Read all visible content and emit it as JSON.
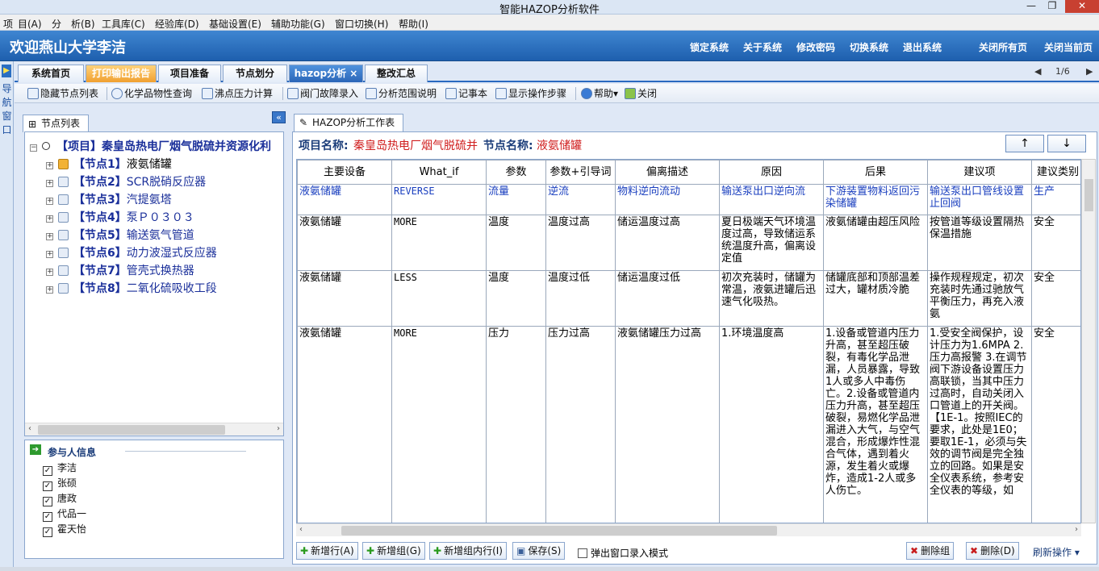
{
  "window": {
    "title": "智能HAZOP分析软件",
    "minimize": "—",
    "restore": "❐",
    "close": "✕"
  },
  "menu": [
    "项",
    "目(A)",
    "分　析(B)",
    "工具库(C)",
    "经验库(D)",
    "基础设置(E)",
    "辅助功能(G)",
    "窗口切换(H)",
    "帮助(I)"
  ],
  "banner": {
    "welcome": "欢迎燕山大学李洁",
    "links": [
      "锁定系统",
      "关于系统",
      "修改密码",
      "切换系统",
      "退出系统",
      "关闭所有页",
      "关闭当前页"
    ]
  },
  "leftnav": {
    "label": "导航窗口"
  },
  "tabs": [
    {
      "label": "系统首页"
    },
    {
      "label": "打印输出报告"
    },
    {
      "label": "项目准备"
    },
    {
      "label": "节点划分"
    },
    {
      "label": "hazop分析 ×"
    },
    {
      "label": "整改汇总"
    }
  ],
  "pager": {
    "page": "1/6"
  },
  "toolbar": [
    {
      "label": "隐藏节点列表"
    },
    {
      "label": "化学品物性查询"
    },
    {
      "label": "沸点压力计算"
    },
    {
      "label": "阀门故障录入"
    },
    {
      "label": "分析范围说明"
    },
    {
      "label": "记事本"
    },
    {
      "label": "显示操作步骤"
    },
    {
      "label": "帮助▾"
    },
    {
      "label": "关闭"
    }
  ],
  "node_panel": {
    "title": "节点列表",
    "collapse": "«",
    "root": "【项目】秦皇岛热电厂烟气脱硫并资源化利",
    "nodes": [
      {
        "num": "【节点1】",
        "name": "液氨储罐"
      },
      {
        "num": "【节点2】",
        "name": "SCR脱硝反应器"
      },
      {
        "num": "【节点3】",
        "name": "汽提氨塔"
      },
      {
        "num": "【节点4】",
        "name": "泵Ｐ０３０３"
      },
      {
        "num": "【节点5】",
        "name": "输送氨气管道"
      },
      {
        "num": "【节点6】",
        "name": "动力波湿式反应器"
      },
      {
        "num": "【节点7】",
        "name": "管壳式换热器"
      },
      {
        "num": "【节点8】",
        "name": "二氧化硫吸收工段"
      }
    ]
  },
  "participants": {
    "title": "参与人信息",
    "names": [
      "李洁",
      "张硕",
      "唐政",
      "代品一",
      "霍天怡"
    ]
  },
  "worksheet": {
    "tab": "HAZOP分析工作表",
    "project_label": "项目名称:",
    "project_value": "秦皇岛热电厂烟气脱硫并",
    "node_label": "节点名称:",
    "node_value": "液氨储罐",
    "up": "↑",
    "down": "↓"
  },
  "table": {
    "headers": [
      "主要设备",
      "What_if",
      "参数",
      "参数+引导词",
      "偏离描述",
      "原因",
      "后果",
      "建议项",
      "建议类别"
    ],
    "rows": [
      [
        "液氨储罐",
        "REVERSE",
        "流量",
        "逆流",
        "物料逆向流动",
        "输送泵出口逆向流",
        "下游装置物料返回污染储罐",
        "输送泵出口管线设置止回阀",
        "生产"
      ],
      [
        "液氨储罐",
        "MORE",
        "温度",
        "温度过高",
        "储运温度过高",
        "夏日极端天气环境温度过高，导致储运系统温度升高，偏离设定值",
        "液氨储罐由超压风险",
        "按管道等级设置隔热保温措施",
        "安全"
      ],
      [
        "液氨储罐",
        "LESS",
        "温度",
        "温度过低",
        "储运温度过低",
        "初次充装时，储罐为常温，液氨进罐后迅速气化吸热。",
        "储罐底部和顶部温差过大，罐材质冷脆",
        "操作规程规定，初次充装时先通过驰放气平衡压力，再充入液氨",
        "安全"
      ],
      [
        "液氨储罐",
        "MORE",
        "压力",
        "压力过高",
        "液氨储罐压力过高",
        "1.环境温度高",
        "1.设备或管道内压力升高，甚至超压破裂，有毒化学品泄漏，人员暴露，导致1人或多人中毒伤亡。2.设备或管道内压力升高，甚至超压破裂，易燃化学品泄漏进入大气，与空气混合，形成爆炸性混合气体，遇到着火源，发生着火或爆炸，造成1-2人或多人伤亡。",
        "1.受安全阀保护，设计压力为1.6MPA 2.压力高报警 3.在调节阀下游设备设置压力高联锁，当其中压力过高时，自动关闭入口管道上的开关阀。【1E-1。按照IEC的要求，此处是1E0；要取1E-1，必须与失效的调节阀是完全独立的回路。如果是安全仪表系统，参考安全仪表的等级，如",
        "安全"
      ]
    ]
  },
  "bottom": {
    "add_row": "新增行(A)",
    "add_group": "新增组(G)",
    "add_in_group": "新增组内行(I)",
    "save": "保存(S)",
    "popup": "弹出窗口录入模式",
    "del_group": "删除组",
    "del": "删除(D)",
    "refresh": "刷新操作 ▾"
  }
}
